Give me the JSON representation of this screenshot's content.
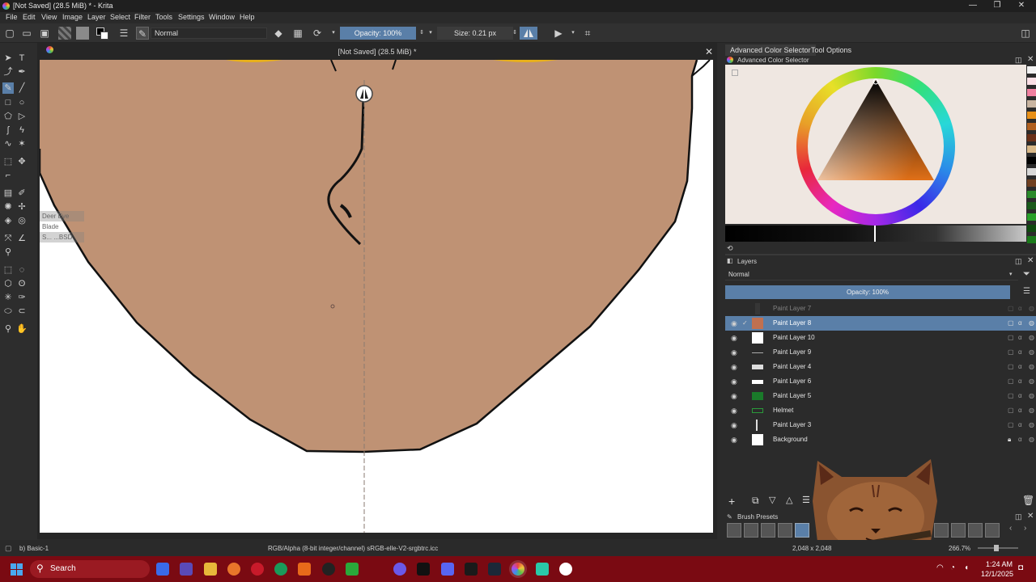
{
  "window": {
    "title": "[Not Saved]  (28.5 MiB) * - Krita",
    "controls": [
      "—",
      "❐",
      "✕"
    ]
  },
  "menu": [
    "File",
    "Edit",
    "View",
    "Image",
    "Layer",
    "Select",
    "Filter",
    "Tools",
    "Settings",
    "Window",
    "Help"
  ],
  "toolbar": {
    "blend_mode": "Normal",
    "opacity": "Opacity: 100%",
    "size": "Size: 0.21 px"
  },
  "document": {
    "title": "[Not Saved]  (28.5 MiB) *",
    "tooltip_1": "Deer Eye Blade",
    "tooltip_2": "S... ...BSD"
  },
  "dock": {
    "tabs": [
      "Advanced Color Selector",
      "Tool Options"
    ],
    "color_panel_title": "Advanced Color Selector",
    "layers_title": "Layers",
    "layers_blend": "Normal",
    "layers_opacity": "Opacity:  100%",
    "brush_presets_title": "Brush Presets"
  },
  "layers": [
    {
      "name": "Paint Layer 7",
      "selected": false,
      "dim": true
    },
    {
      "name": "Paint Layer 8",
      "selected": true,
      "dim": false
    },
    {
      "name": "Paint Layer 10",
      "selected": false,
      "dim": false
    },
    {
      "name": "Paint Layer 9",
      "selected": false,
      "dim": false
    },
    {
      "name": "Paint Layer 4",
      "selected": false,
      "dim": false
    },
    {
      "name": "Paint Layer 6",
      "selected": false,
      "dim": false
    },
    {
      "name": "Paint Layer 5",
      "selected": false,
      "dim": false
    },
    {
      "name": "Helmet",
      "selected": false,
      "dim": false
    },
    {
      "name": "Paint Layer 3",
      "selected": false,
      "dim": false
    },
    {
      "name": "Background",
      "selected": false,
      "dim": false
    }
  ],
  "status": {
    "brush": "b) Basic-1",
    "color_profile": "RGB/Alpha (8-bit integer/channel)  sRGB-elle-V2-srgbtrc.icc",
    "dimensions": "2,048 x 2,048",
    "zoom": "266.7%"
  },
  "taskbar": {
    "search": "Search",
    "time": "1:24 AM",
    "date": "12/1/2025"
  },
  "colors": {
    "skin": "#bf9274",
    "accent": "#5a7fa8",
    "taskbar": "#7a0a12"
  }
}
